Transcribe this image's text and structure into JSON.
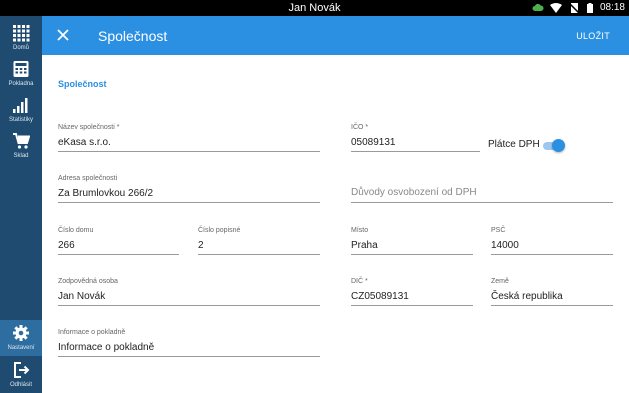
{
  "statusbar": {
    "title": "Jan Novák",
    "time": "08:18",
    "icons": [
      "cloud-icon",
      "wifi-icon",
      "no-sim-icon",
      "battery-icon"
    ]
  },
  "sidebar": {
    "items": [
      {
        "label": "Domů",
        "icon": "grid-icon"
      },
      {
        "label": "Pokladna",
        "icon": "calculator-icon"
      },
      {
        "label": "Statistiky",
        "icon": "bar-chart-icon"
      },
      {
        "label": "Sklad",
        "icon": "cart-icon"
      },
      {
        "label": "Nastavení",
        "icon": "gear-icon"
      },
      {
        "label": "Odhlásit",
        "icon": "logout-icon"
      }
    ]
  },
  "appbar": {
    "title": "Společnost",
    "save_label": "ULOŽIT"
  },
  "colors": {
    "accent": "#2b8fe2",
    "sidebar": "#1e4b6f",
    "sidebar_active": "#2e6da0"
  },
  "form": {
    "section_title": "Společnost",
    "company_name": {
      "label": "Název společnosti *",
      "value": "eKasa s.r.o."
    },
    "ico": {
      "label": "IČO *",
      "value": "05089131"
    },
    "vat_payer": {
      "label": "Plátce DPH",
      "checked": true
    },
    "address": {
      "label": "Adresa společnosti",
      "value": "Za Brumlovkou 266/2"
    },
    "vat_exempt_reason": {
      "placeholder": "Důvody osvobození od DPH"
    },
    "house_number": {
      "label": "Číslo domu",
      "value": "266"
    },
    "descriptive_number": {
      "label": "Číslo popisné",
      "value": "2"
    },
    "city": {
      "label": "Místo",
      "value": "Praha"
    },
    "zip": {
      "label": "PSČ",
      "value": "14000"
    },
    "responsible_person": {
      "label": "Zodpovědná osoba",
      "value": "Jan Novák"
    },
    "dic": {
      "label": "DIČ *",
      "value": "CZ05089131"
    },
    "country": {
      "label": "Země",
      "value": "Česká republika"
    },
    "register_info": {
      "label": "Informace o pokladně",
      "value": "Informace o pokladně"
    }
  }
}
